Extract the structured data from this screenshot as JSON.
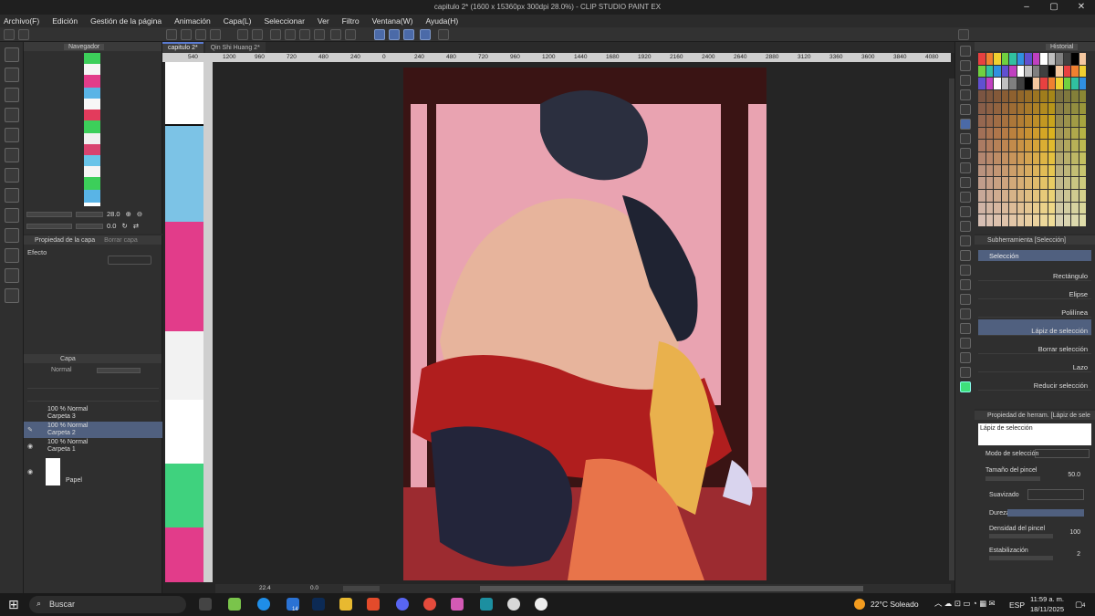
{
  "window": {
    "title": "capitulo 2* (1600 x 15360px 300dpi 28.0%)  - CLIP STUDIO PAINT EX",
    "controls": [
      "–",
      "▢",
      "✕"
    ]
  },
  "menu": [
    "Archivo(F)",
    "Edición",
    "Gestión de la página",
    "Animación",
    "Capa(L)",
    "Seleccionar",
    "Ver",
    "Filtro",
    "Ventana(W)",
    "Ayuda(H)"
  ],
  "panels": {
    "navigator": {
      "title": "Navegador",
      "zoom": "28.0",
      "angle": "0.0"
    },
    "layer_property": {
      "title": "Propiedad de la capa",
      "tab2": "Borrar capa",
      "effect_label": "Efecto"
    },
    "layers": {
      "title": "Capa",
      "blend": "Normal",
      "items": [
        {
          "opacity": "100 %",
          "mode": "Normal",
          "name": "Carpeta 3",
          "selected": false,
          "visible": false
        },
        {
          "opacity": "100 %",
          "mode": "Normal",
          "name": "Carpeta 2",
          "selected": true,
          "visible": false
        },
        {
          "opacity": "100 %",
          "mode": "Normal",
          "name": "Carpeta 1",
          "selected": false,
          "visible": true
        },
        {
          "opacity": "",
          "mode": "",
          "name": "Papel",
          "selected": false,
          "visible": true
        }
      ]
    }
  },
  "document": {
    "tabs": [
      {
        "label": "capitulo 2*",
        "active": true
      },
      {
        "label": "Qin Shi Huang 2*",
        "active": false
      }
    ],
    "ruler_left": [
      "540"
    ],
    "ruler_top": [
      "1200",
      "960",
      "720",
      "480",
      "240",
      "0",
      "240",
      "480",
      "720",
      "960",
      "1200",
      "1440",
      "1680",
      "1920",
      "2160",
      "2400",
      "2640",
      "2880",
      "3120",
      "3360",
      "3600",
      "3840",
      "4080"
    ],
    "status": {
      "zoom": "22.4",
      "angle": "0.0"
    }
  },
  "right": {
    "palette_tab": "Historial",
    "subtool": {
      "title": "Subherramienta [Selección]",
      "group": "Selección",
      "items": [
        {
          "label": "Rectángulo",
          "selected": false
        },
        {
          "label": "Elipse",
          "selected": false
        },
        {
          "label": "Polilínea",
          "selected": false
        },
        {
          "label": "Lápiz de selección",
          "selected": true
        },
        {
          "label": "Borrar selección",
          "selected": false
        },
        {
          "label": "Lazo",
          "selected": false
        },
        {
          "label": "Reducir selección",
          "selected": false
        }
      ]
    },
    "tool_property": {
      "title": "Propiedad de herram. [Lápiz de sele",
      "preset": "Lápiz de selección",
      "mode_label": "Modo de selección",
      "brush_size_label": "Tamaño del pincel",
      "brush_size": "50.0",
      "smoothing_label": "Suavizado",
      "hardness_label": "Dureza",
      "density_label": "Densidad del pincel",
      "density": "100",
      "stabilization_label": "Estabilización",
      "stabilization": "2"
    }
  },
  "taskbar": {
    "search": "Buscar",
    "badge": "14",
    "weather": "22°C  Soleado",
    "lang": "ESP",
    "time": "11:59 a. m.",
    "date": "18/11/2025",
    "notif": "4"
  },
  "colors": {
    "accent": "#50607f",
    "fg_color": "#3ee07a",
    "art_bg_frame": "#3a1414",
    "art_pink": "#e9a3b1",
    "art_red": "#b01e1e"
  }
}
